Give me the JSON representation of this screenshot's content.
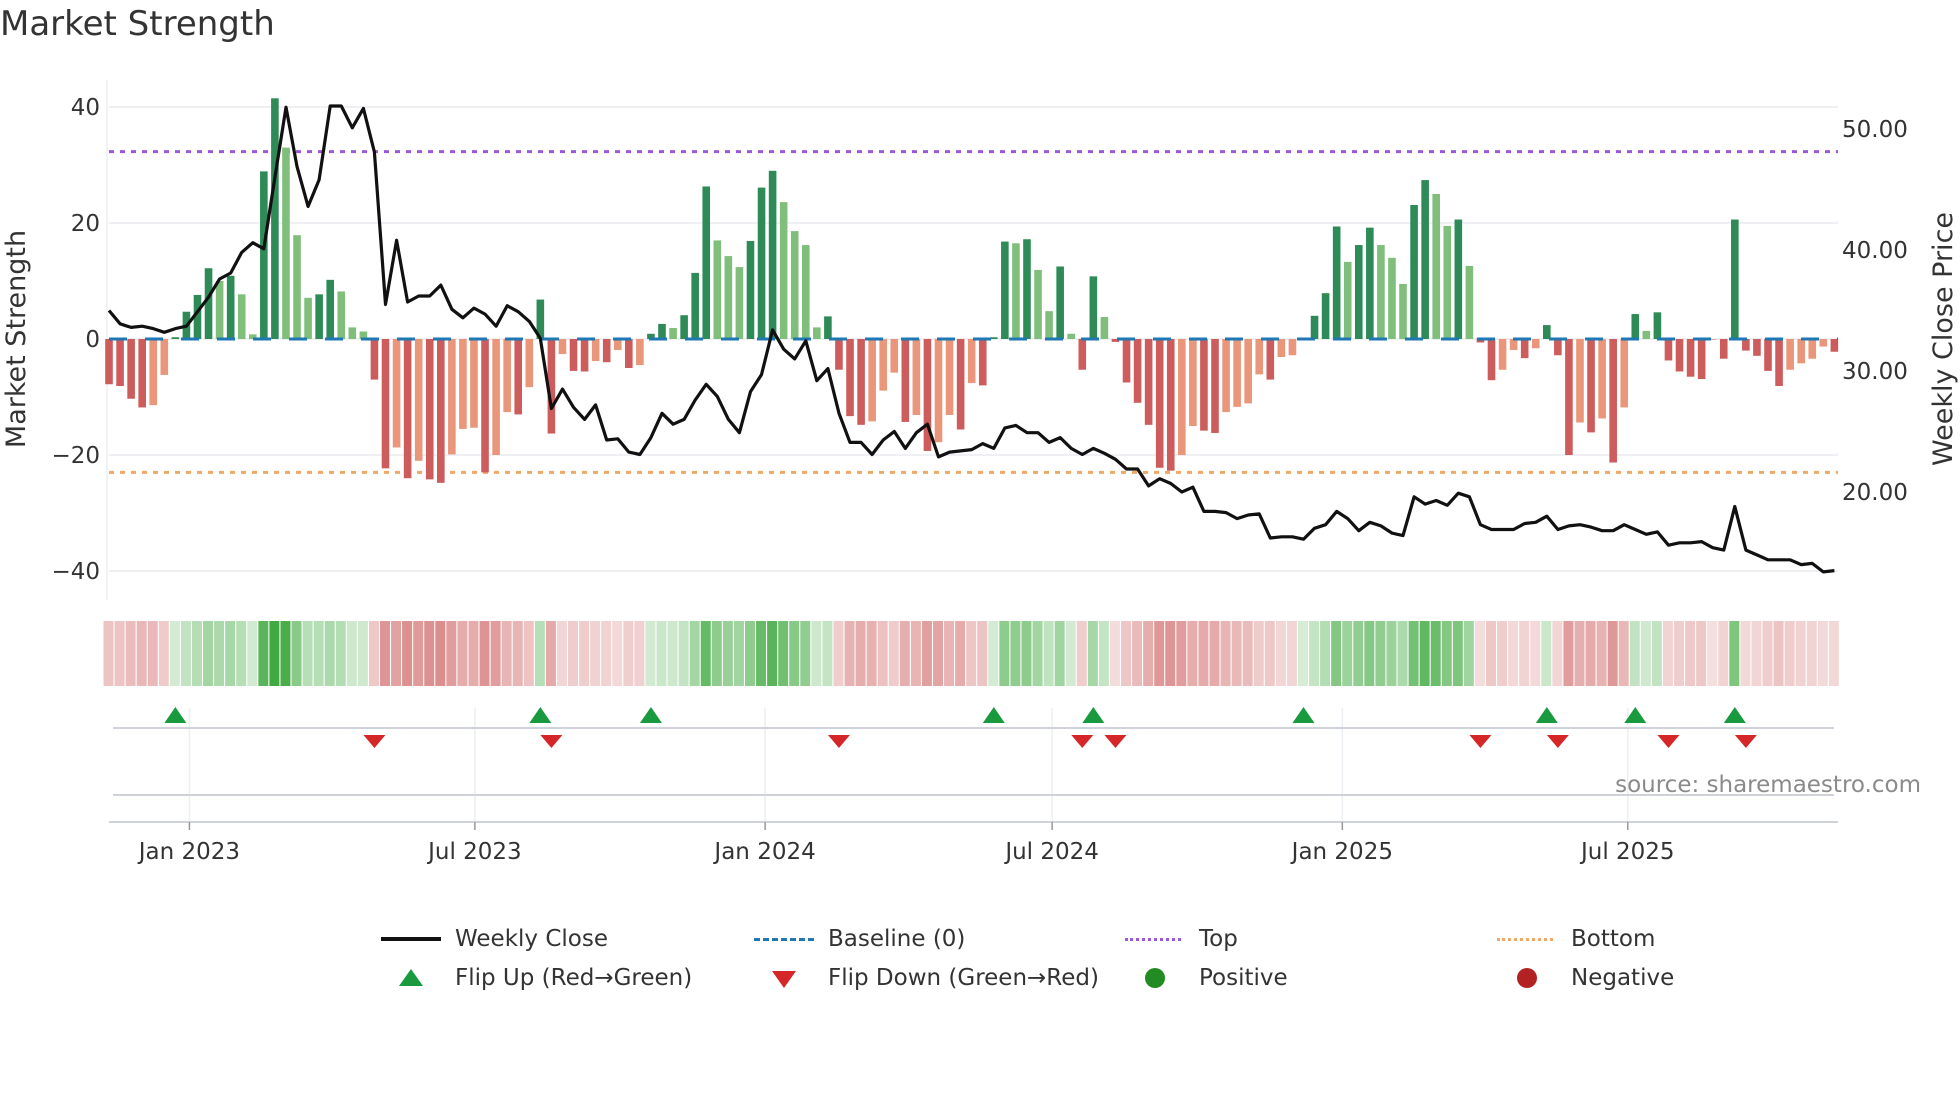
{
  "title": "Market Strength",
  "source": "source: sharemaestro.com",
  "colors": {
    "strong_green": "#2e8b57",
    "weak_green": "#7fbf7b",
    "strong_red": "#cd5c5c",
    "weak_red": "#e9967a",
    "baseline": "#1f77b4",
    "top": "#9b59d9",
    "bottom": "#f0a868",
    "flip_up": "#1a9a3f",
    "flip_down": "#d62728",
    "positive": "#228b22",
    "negative": "#b22222",
    "line": "#111111"
  },
  "legend": [
    {
      "label": "Weekly Close",
      "kind": "line"
    },
    {
      "label": "Baseline (0)",
      "kind": "baseline"
    },
    {
      "label": "Top",
      "kind": "top"
    },
    {
      "label": "Bottom",
      "kind": "bottom"
    },
    {
      "label": "Flip Up (Red→Green)",
      "kind": "flip_up"
    },
    {
      "label": "Flip Down (Green→Red)",
      "kind": "flip_down"
    },
    {
      "label": "Positive",
      "kind": "positive"
    },
    {
      "label": "Negative",
      "kind": "negative"
    }
  ],
  "chart_data": {
    "type": "bar",
    "title": "Market Strength",
    "ylabel": "Market Strength",
    "y2label": "Weekly Close Price",
    "ylim": [
      -44,
      45
    ],
    "y2lim": [
      12.6,
      53.3
    ],
    "yticks": [
      "40",
      "20",
      "0",
      "−20",
      "−40"
    ],
    "ytick_values": [
      40,
      20,
      0,
      -20,
      -40
    ],
    "y2ticks": [
      "50.00",
      "40.00",
      "30.00",
      "20.00"
    ],
    "y2tick_values": [
      50,
      40,
      30,
      20
    ],
    "x_start": "2022-11-11",
    "x_step_days": 7,
    "xticks": [
      {
        "label": "Jan 2023",
        "date": "2023-01-01"
      },
      {
        "label": "Jul 2023",
        "date": "2023-07-01"
      },
      {
        "label": "Jan 2024",
        "date": "2024-01-01"
      },
      {
        "label": "Jul 2024",
        "date": "2024-07-01"
      },
      {
        "label": "Jan 2025",
        "date": "2025-01-01"
      },
      {
        "label": "Jul 2025",
        "date": "2025-07-01"
      }
    ],
    "top_level": 32.3,
    "bottom_level": -23.0,
    "baseline": 0,
    "series": [
      {
        "name": "Market Strength",
        "values": [
          -7.8,
          -8.1,
          -10.3,
          -11.8,
          -11.4,
          -6.2,
          0.3,
          4.7,
          7.6,
          12.2,
          10.0,
          10.9,
          7.7,
          0.8,
          28.9,
          41.5,
          33.0,
          17.9,
          7.1,
          7.7,
          10.2,
          8.2,
          2.0,
          1.3,
          -7.0,
          -22.3,
          -18.7,
          -24.0,
          -21.0,
          -24.2,
          -24.8,
          -19.9,
          -15.5,
          -15.3,
          -23.0,
          -20.0,
          -12.6,
          -13.0,
          -8.3,
          6.8,
          -16.3,
          -2.6,
          -5.5,
          -5.6,
          -3.8,
          -4.0,
          -1.9,
          -5.0,
          -4.5,
          0.9,
          2.6,
          1.9,
          4.1,
          11.4,
          26.3,
          17.0,
          14.3,
          12.4,
          16.9,
          26.1,
          29.0,
          23.6,
          18.6,
          16.2,
          2.0,
          3.9,
          -5.3,
          -13.3,
          -14.8,
          -14.2,
          -8.9,
          -5.8,
          -14.3,
          -13.1,
          -19.3,
          -17.8,
          -13.1,
          -15.6,
          -7.6,
          -8.0,
          0.3,
          16.8,
          16.5,
          17.2,
          11.9,
          4.8,
          12.5,
          0.9,
          -5.3,
          10.8,
          3.8,
          -0.5,
          -7.5,
          -11.0,
          -14.8,
          -22.2,
          -22.7,
          -20.0,
          -15.0,
          -15.8,
          -16.2,
          -12.6,
          -11.7,
          -11.1,
          -6.1,
          -7.0,
          -3.1,
          -2.8,
          0.2,
          4.0,
          7.9,
          19.4,
          13.3,
          16.2,
          19.2,
          16.2,
          14.0,
          9.5,
          23.1,
          27.4,
          25.0,
          19.5,
          20.6,
          12.6,
          -0.6,
          -7.1,
          -5.3,
          -1.9,
          -3.3,
          -1.6,
          2.4,
          -2.8,
          -20.0,
          -14.4,
          -16.1,
          -13.7,
          -21.3,
          -11.8,
          4.3,
          1.4,
          4.6,
          -3.7,
          -5.6,
          -6.5,
          -6.9,
          -0.1,
          -3.4,
          20.6,
          -2.0,
          -2.9,
          -5.5,
          -8.1,
          -5.3,
          -4.2,
          -3.4,
          -1.3,
          -2.2
        ]
      },
      {
        "name": "Weekly Close",
        "axis": "right",
        "values": [
          35.0,
          33.9,
          33.6,
          33.7,
          33.5,
          33.2,
          33.5,
          33.7,
          34.9,
          36.1,
          37.6,
          38.1,
          39.8,
          40.6,
          40.1,
          46.0,
          51.8,
          46.9,
          43.6,
          45.8,
          51.9,
          51.9,
          50.1,
          51.7,
          48.1,
          35.5,
          40.8,
          35.7,
          36.2,
          36.2,
          37.1,
          35.1,
          34.4,
          35.2,
          34.7,
          33.7,
          35.4,
          34.9,
          34.1,
          32.7,
          26.9,
          28.5,
          27.0,
          26.0,
          27.2,
          24.3,
          24.4,
          23.3,
          23.1,
          24.5,
          26.5,
          25.6,
          26.0,
          27.6,
          28.9,
          27.9,
          26.0,
          24.9,
          28.3,
          29.7,
          33.4,
          31.8,
          31.0,
          32.5,
          29.2,
          30.2,
          26.5,
          24.1,
          24.1,
          23.1,
          24.3,
          25.0,
          23.6,
          24.9,
          25.6,
          22.9,
          23.3,
          23.4,
          23.5,
          24.0,
          23.6,
          25.3,
          25.5,
          24.9,
          24.9,
          24.1,
          24.5,
          23.6,
          23.1,
          23.6,
          23.2,
          22.7,
          21.9,
          21.9,
          20.5,
          21.1,
          20.7,
          20.0,
          20.4,
          18.4,
          18.4,
          18.3,
          17.8,
          18.1,
          18.2,
          16.2,
          16.3,
          16.3,
          16.1,
          17.0,
          17.3,
          18.4,
          17.8,
          16.8,
          17.5,
          17.2,
          16.6,
          16.4,
          19.6,
          19.0,
          19.3,
          18.9,
          19.9,
          19.6,
          17.3,
          16.9,
          16.9,
          16.9,
          17.4,
          17.5,
          18.0,
          16.9,
          17.2,
          17.3,
          17.1,
          16.8,
          16.8,
          17.3,
          16.9,
          16.5,
          16.7,
          15.6,
          15.8,
          15.8,
          15.9,
          15.4,
          15.2,
          18.8,
          15.2,
          14.8,
          14.4,
          14.4,
          14.4,
          14.0,
          14.1,
          13.4,
          13.5
        ]
      }
    ],
    "legend_position": "bottom"
  }
}
